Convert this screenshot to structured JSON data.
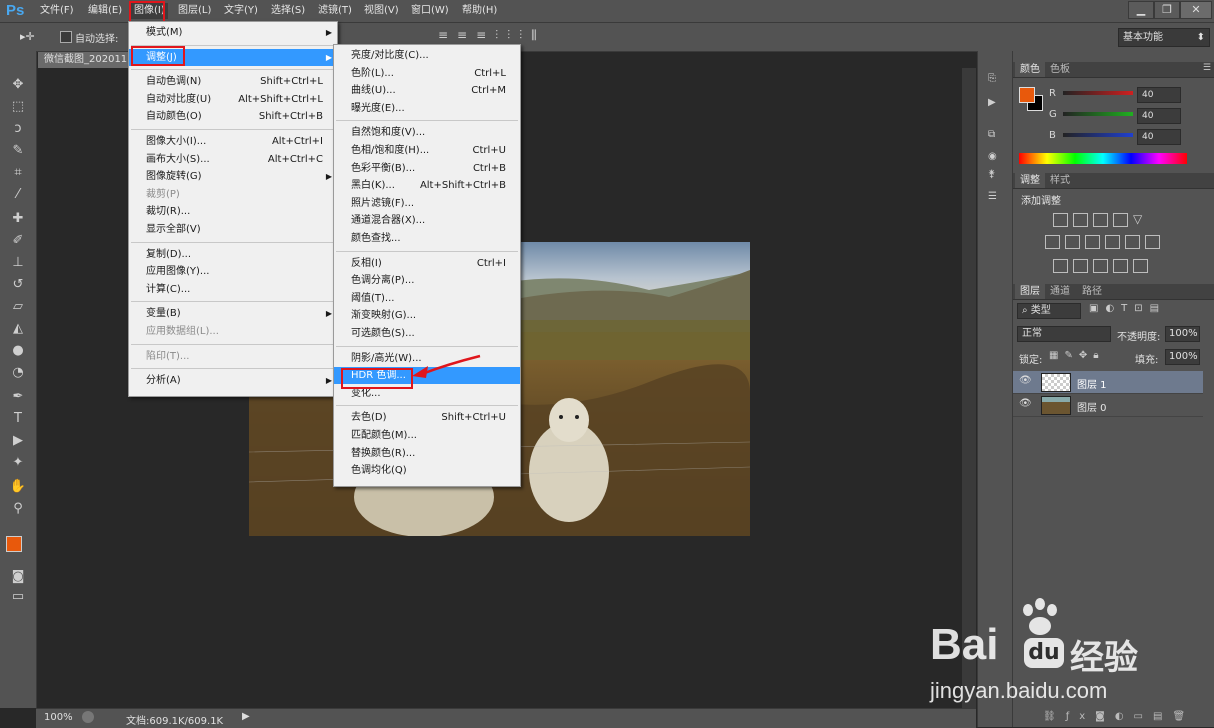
{
  "app": {
    "logo": "Ps"
  },
  "menubar": {
    "items": [
      "文件(F)",
      "编辑(E)",
      "图像(I)",
      "图层(L)",
      "文字(Y)",
      "选择(S)",
      "滤镜(T)",
      "视图(V)",
      "窗口(W)",
      "帮助(H)"
    ],
    "active_index": 2
  },
  "window_controls": [
    "minimize-icon",
    "restore-icon",
    "close-icon"
  ],
  "options": {
    "auto_select_label": "自动选择:",
    "workspace": "基本功能"
  },
  "document": {
    "tab_title": "微信截图_202011"
  },
  "status": {
    "zoom": "100%",
    "doc_info": "文档:609.1K/609.1K"
  },
  "image_menu": {
    "items": [
      {
        "label": "模式(M)",
        "submenu": true
      },
      {
        "sep": true
      },
      {
        "label": "调整(J)",
        "submenu": true,
        "highlighted": true
      },
      {
        "sep": true
      },
      {
        "label": "自动色调(N)",
        "shortcut": "Shift+Ctrl+L"
      },
      {
        "label": "自动对比度(U)",
        "shortcut": "Alt+Shift+Ctrl+L"
      },
      {
        "label": "自动颜色(O)",
        "shortcut": "Shift+Ctrl+B"
      },
      {
        "sep": true
      },
      {
        "label": "图像大小(I)...",
        "shortcut": "Alt+Ctrl+I"
      },
      {
        "label": "画布大小(S)...",
        "shortcut": "Alt+Ctrl+C"
      },
      {
        "label": "图像旋转(G)",
        "submenu": true
      },
      {
        "label": "裁剪(P)",
        "disabled": true
      },
      {
        "label": "裁切(R)..."
      },
      {
        "label": "显示全部(V)"
      },
      {
        "sep": true
      },
      {
        "label": "复制(D)..."
      },
      {
        "label": "应用图像(Y)..."
      },
      {
        "label": "计算(C)..."
      },
      {
        "sep": true
      },
      {
        "label": "变量(B)",
        "submenu": true
      },
      {
        "label": "应用数据组(L)...",
        "disabled": true
      },
      {
        "sep": true
      },
      {
        "label": "陷印(T)...",
        "disabled": true
      },
      {
        "sep": true
      },
      {
        "label": "分析(A)",
        "submenu": true
      }
    ]
  },
  "adjust_menu": {
    "items": [
      {
        "label": "亮度/对比度(C)..."
      },
      {
        "label": "色阶(L)...",
        "shortcut": "Ctrl+L"
      },
      {
        "label": "曲线(U)...",
        "shortcut": "Ctrl+M"
      },
      {
        "label": "曝光度(E)..."
      },
      {
        "sep": true
      },
      {
        "label": "自然饱和度(V)..."
      },
      {
        "label": "色相/饱和度(H)...",
        "shortcut": "Ctrl+U"
      },
      {
        "label": "色彩平衡(B)...",
        "shortcut": "Ctrl+B"
      },
      {
        "label": "黑白(K)...",
        "shortcut": "Alt+Shift+Ctrl+B"
      },
      {
        "label": "照片滤镜(F)..."
      },
      {
        "label": "通道混合器(X)..."
      },
      {
        "label": "颜色查找..."
      },
      {
        "sep": true
      },
      {
        "label": "反相(I)",
        "shortcut": "Ctrl+I"
      },
      {
        "label": "色调分离(P)..."
      },
      {
        "label": "阈值(T)..."
      },
      {
        "label": "渐变映射(G)..."
      },
      {
        "label": "可选颜色(S)..."
      },
      {
        "sep": true
      },
      {
        "label": "阴影/高光(W)..."
      },
      {
        "label": "HDR 色调...",
        "highlighted": true
      },
      {
        "label": "变化..."
      },
      {
        "sep": true
      },
      {
        "label": "去色(D)",
        "shortcut": "Shift+Ctrl+U"
      },
      {
        "label": "匹配颜色(M)..."
      },
      {
        "label": "替换颜色(R)..."
      },
      {
        "label": "色调均化(Q)"
      }
    ]
  },
  "color_panel": {
    "tabs": [
      "颜色",
      "色板"
    ],
    "foreground": "#e8590c",
    "background": "#000000",
    "channels": [
      {
        "label": "R",
        "value": "40",
        "color": "#d02020"
      },
      {
        "label": "G",
        "value": "40",
        "color": "#20b020"
      },
      {
        "label": "B",
        "value": "40",
        "color": "#2040d0"
      }
    ]
  },
  "adjustments_panel": {
    "tabs": [
      "调整",
      "样式"
    ],
    "add_label": "添加调整"
  },
  "layers_panel": {
    "tabs": [
      "图层",
      "通道",
      "路径"
    ],
    "filter_label": "类型",
    "blend_mode": "正常",
    "opacity_label": "不透明度:",
    "opacity_value": "100%",
    "lock_label": "锁定:",
    "fill_label": "填充:",
    "fill_value": "100%",
    "layers": [
      {
        "name": "图层 1",
        "selected": true
      },
      {
        "name": "图层 0",
        "selected": false
      }
    ]
  },
  "watermark": {
    "brand": "Bai",
    "brand_suffix": "经验",
    "url": "jingyan.baidu.com"
  },
  "accent": "#3399ff",
  "annotation_color": "#e0161c"
}
